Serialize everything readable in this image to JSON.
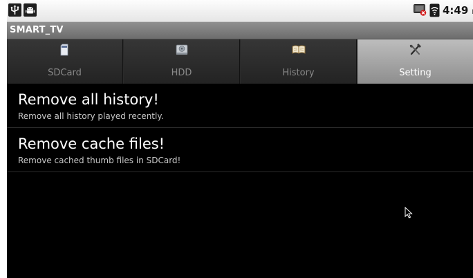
{
  "status_bar": {
    "time": "4:49",
    "ampm": "PM",
    "icons": [
      "usb-icon",
      "android-debug-icon",
      "tv-disconnected-icon",
      "wifi-icon"
    ]
  },
  "app": {
    "title": "SMART_TV"
  },
  "tabs": [
    {
      "label": "SDCard",
      "icon": "sdcard-icon",
      "selected": false
    },
    {
      "label": "HDD",
      "icon": "hdd-icon",
      "selected": false
    },
    {
      "label": "History",
      "icon": "book-icon",
      "selected": false
    },
    {
      "label": "Setting",
      "icon": "tools-icon",
      "selected": true
    }
  ],
  "settings": [
    {
      "title": "Remove all history!",
      "subtitle": "Remove all history played recently."
    },
    {
      "title": "Remove cache files!",
      "subtitle": "Remove cached thumb files in SDCard!"
    }
  ],
  "colors": {
    "background": "#000000",
    "tab_selected": "#a8a8a8",
    "tab_unselected": "#2c2c2c",
    "title_bar": "#7d7d7d"
  }
}
